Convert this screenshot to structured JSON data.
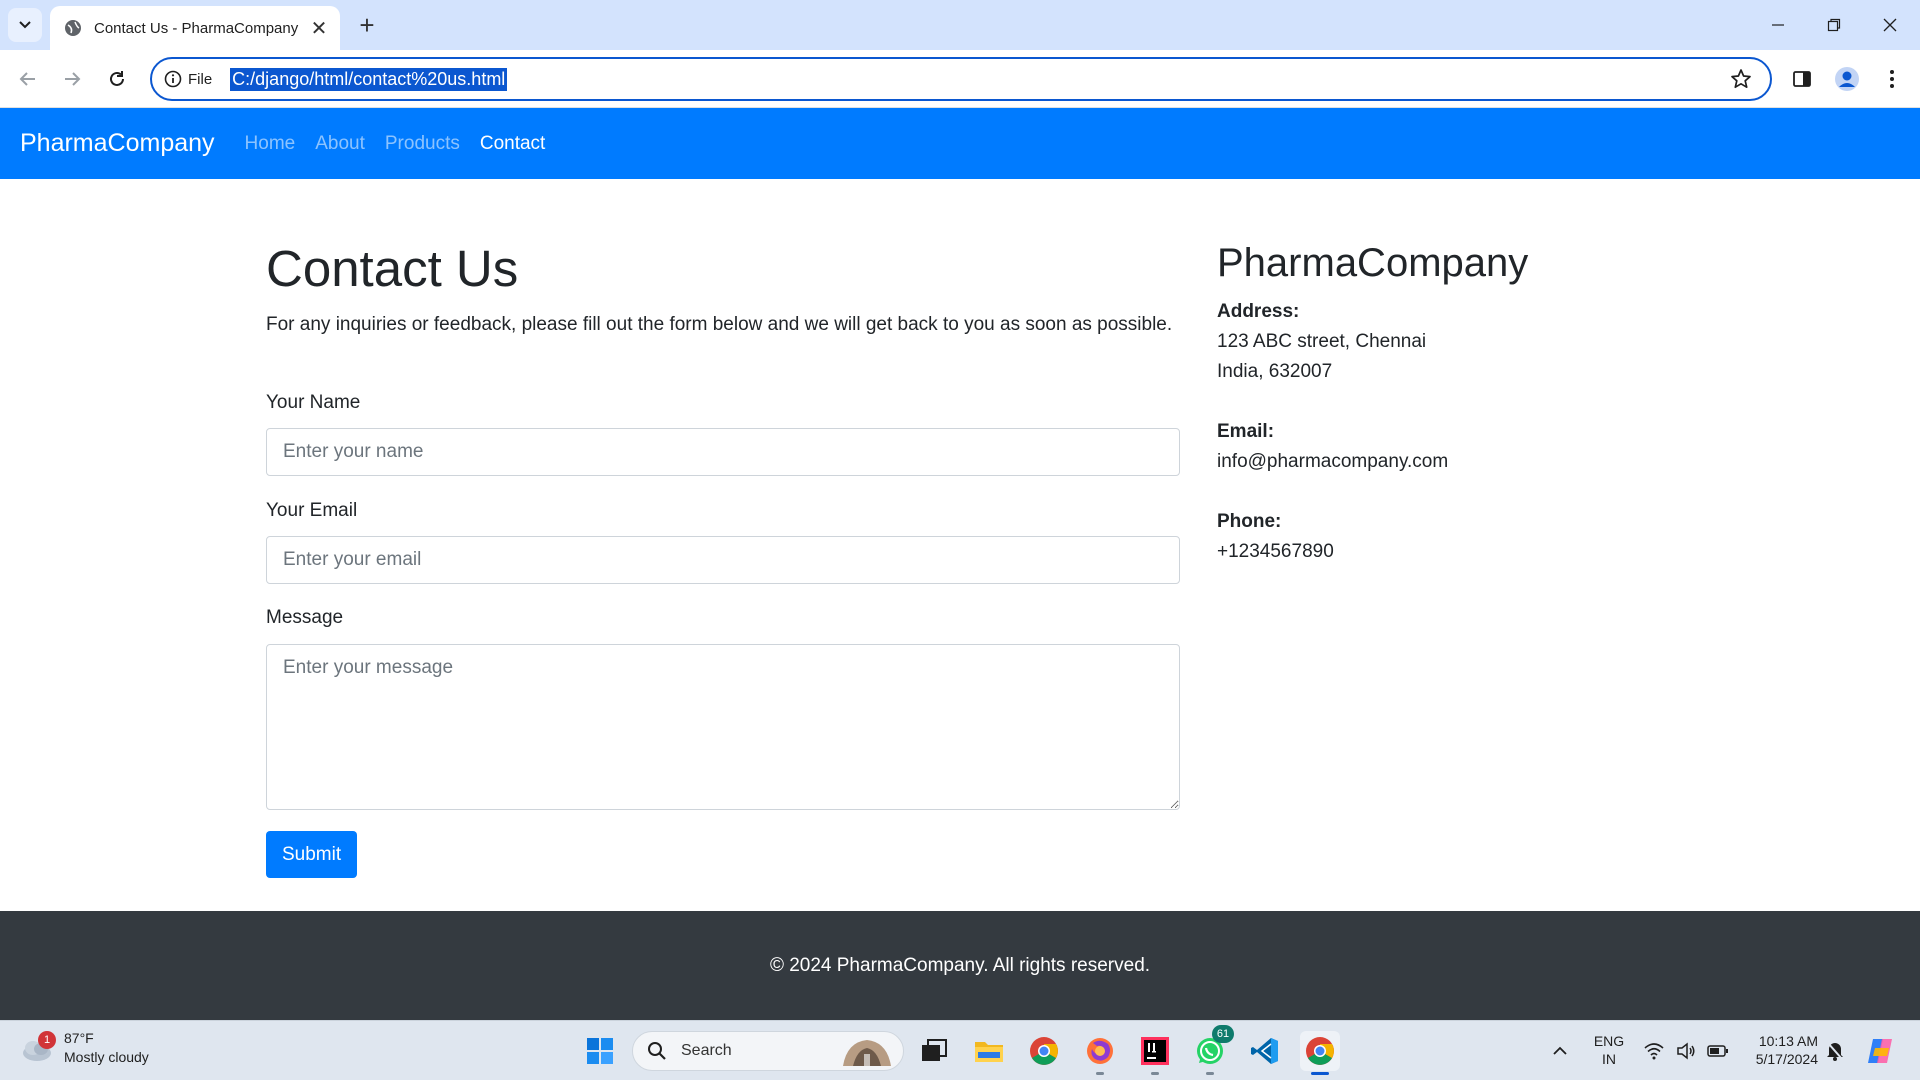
{
  "browser": {
    "tab_title": "Contact Us - PharmaCompany",
    "new_tab": "+",
    "close_tab": "✕",
    "address_prefix": "File",
    "url": "C:/django/html/contact%20us.html"
  },
  "navbar": {
    "brand": "PharmaCompany",
    "links": [
      "Home",
      "About",
      "Products",
      "Contact"
    ],
    "active": "Contact"
  },
  "contact": {
    "title": "Contact Us",
    "intro": "For any inquiries or feedback, please fill out the form below and we will get back to you as soon as possible.",
    "name_label": "Your Name",
    "name_placeholder": "Enter your name",
    "email_label": "Your Email",
    "email_placeholder": "Enter your email",
    "message_label": "Message",
    "message_placeholder": "Enter your message",
    "submit_label": "Submit"
  },
  "company": {
    "name": "PharmaCompany",
    "address_label": "Address:",
    "address_line1": "123 ABC street, Chennai",
    "address_line2": "India, 632007",
    "email_label": "Email:",
    "email": "info@pharmacompany.com",
    "phone_label": "Phone:",
    "phone": "+1234567890"
  },
  "footer": {
    "text": "© 2024 PharmaCompany. All rights reserved."
  },
  "taskbar": {
    "weather_temp": "87°F",
    "weather_desc": "Mostly cloudy",
    "weather_badge": "1",
    "search_label": "Search",
    "whatsapp_badge": "61",
    "lang_top": "ENG",
    "lang_bottom": "IN",
    "time": "10:13 AM",
    "date": "5/17/2024"
  },
  "colors": {
    "navbar": "#007bff",
    "footer": "#343a40",
    "accent": "#0b57d0"
  }
}
